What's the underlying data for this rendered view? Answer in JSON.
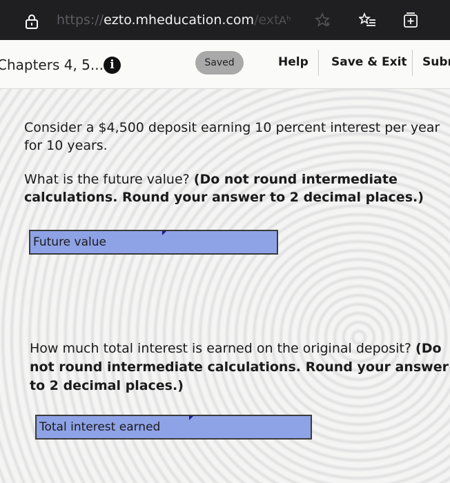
{
  "browser": {
    "url_scheme": "https://",
    "url_domain": "ezto.mheducation.com",
    "url_tail": "/ext",
    "reader_label": "Aʰ"
  },
  "header": {
    "assignment_title": "Chapters 4, 5...",
    "info_symbol": "i",
    "saved_label": "Saved",
    "help_label": "Help",
    "save_exit_label": "Save & Exit",
    "submit_label": "Subm"
  },
  "question": {
    "prompt": "Consider a $4,500 deposit earning 10 percent interest per year for 10 years.",
    "part1_text": "What is the future value? ",
    "part1_instructions": "(Do not round intermediate calculations. Round your answer to 2 decimal places.)",
    "part1_label": "Future value",
    "part1_value": "",
    "part2_text": "How much total interest is earned on the original deposit? ",
    "part2_instructions": "(Do not round intermediate calculations. Round your answer to 2 decimal places.)",
    "part2_label": "Total interest earned",
    "part2_value": ""
  },
  "colors": {
    "browser_bar": "#1f1f21",
    "input_fill": "#8ea2e6",
    "saved_badge": "#a9a9a9"
  }
}
